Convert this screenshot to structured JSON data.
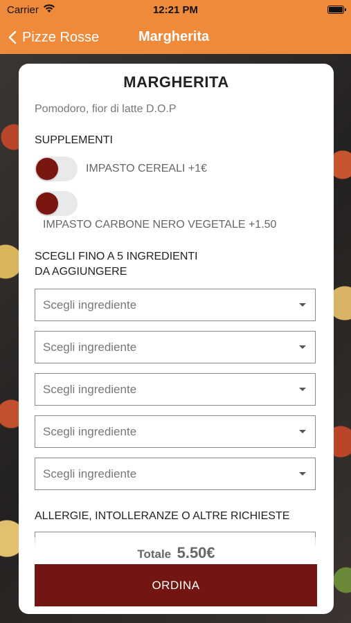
{
  "status": {
    "carrier": "Carrier",
    "time": "12:21 PM"
  },
  "nav": {
    "back_label": "Pizze Rosse",
    "title": "Margherita"
  },
  "product": {
    "name": "MARGHERITA",
    "description": "Pomodoro, fior di latte D.O.P"
  },
  "supplements": {
    "heading": "SUPPLEMENTI",
    "items": [
      {
        "label": "IMPASTO CEREALI +1€",
        "on": false
      },
      {
        "label": "IMPASTO CARBONE NERO VEGETALE +1.50",
        "on": false
      }
    ]
  },
  "ingredients": {
    "heading_line1": "SCEGLI FINO A 5 INGREDIENTI",
    "heading_line2": "DA AGGIUNGERE",
    "selects": [
      {
        "placeholder": "Scegli ingrediente"
      },
      {
        "placeholder": "Scegli ingrediente"
      },
      {
        "placeholder": "Scegli ingrediente"
      },
      {
        "placeholder": "Scegli ingrediente"
      },
      {
        "placeholder": "Scegli ingrediente"
      }
    ]
  },
  "requests": {
    "heading": "ALLERGIE, INTOLLERANZE O ALTRE RICHIESTE"
  },
  "total": {
    "label": "Totale",
    "value": "5.50€"
  },
  "order_button": "ORDINA",
  "colors": {
    "header": "#ee8a3a",
    "accent": "#731510",
    "toggle_knob": "#7a1610"
  }
}
